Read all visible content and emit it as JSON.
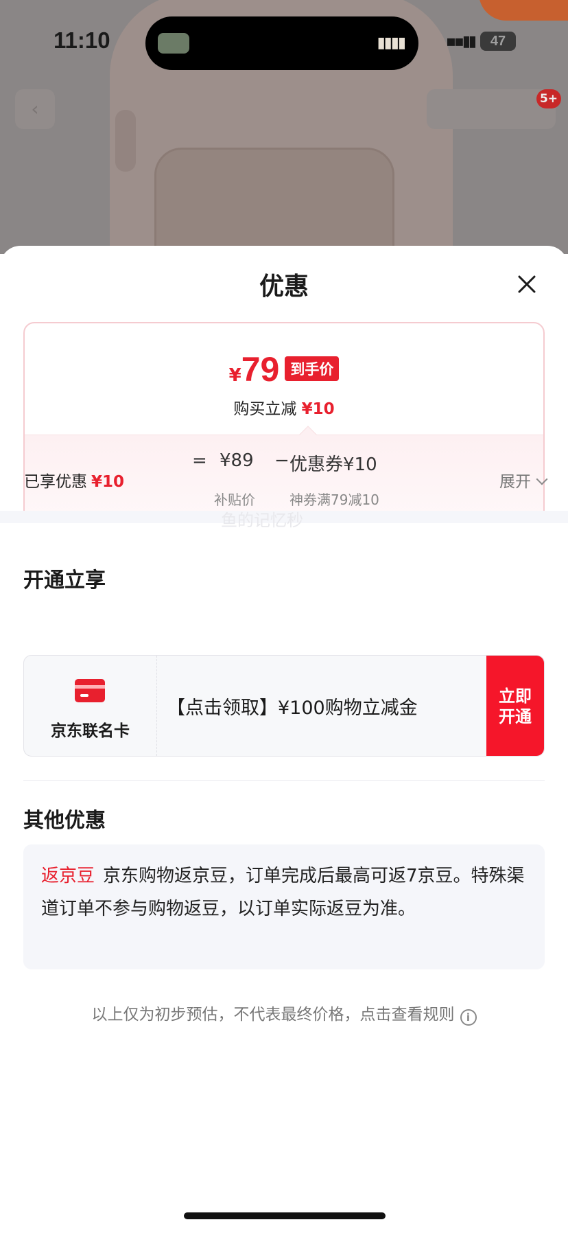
{
  "status_bar": {
    "time": "11:10",
    "battery": "47"
  },
  "background_page": {
    "notification_count": "5+"
  },
  "sheet": {
    "title": "优惠",
    "price_card": {
      "currency": "¥",
      "final_price": "79",
      "final_tag": "到手价",
      "instant_discount_label": "购买立减",
      "instant_discount_value": "¥10",
      "calc_equals": "=",
      "subsidy_price": "¥89",
      "calc_minus": "−",
      "coupon": "优惠券¥10",
      "subsidy_label": "补贴价",
      "coupon_detail": "神券满79减10"
    },
    "enjoyed": {
      "label": "已享优惠",
      "value": "¥10"
    },
    "expand_label": "展开",
    "watermark": "鱼的记忆秒",
    "open_section": {
      "title": "开通立享",
      "card_name": "京东联名卡",
      "offer_text": "【点击领取】¥100购物立减金",
      "button_line1": "立即",
      "button_line2": "开通"
    },
    "other_section": {
      "title": "其他优惠",
      "tag": "返京豆",
      "text": "京东购物返京豆，订单完成后最高可返7京豆。特殊渠道订单不参与购物返豆，以订单实际返豆为准。"
    },
    "footnote": "以上仅为初步预估，不代表最终价格，点击查看规则"
  }
}
